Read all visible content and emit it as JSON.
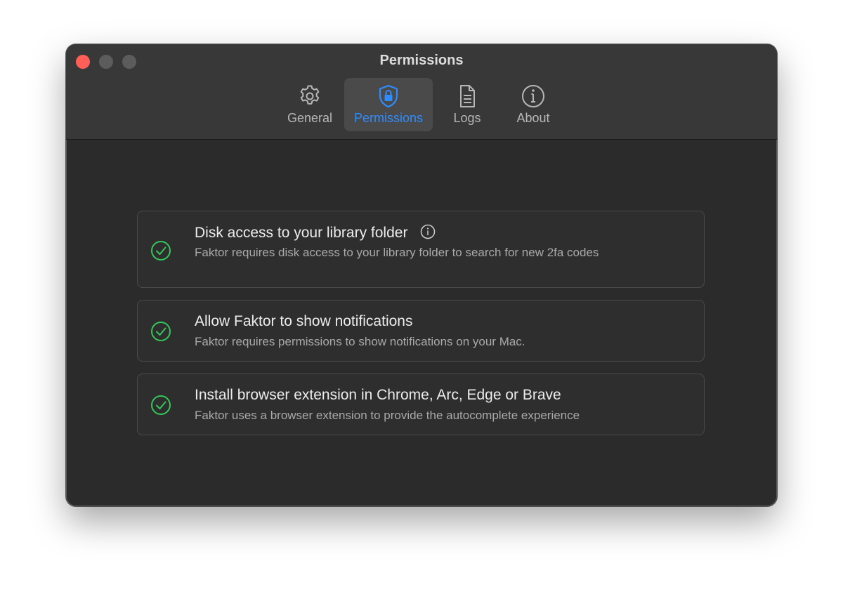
{
  "window": {
    "title": "Permissions"
  },
  "tabs": [
    {
      "label": "General",
      "icon": "gear-icon",
      "active": false
    },
    {
      "label": "Permissions",
      "icon": "shield-lock-icon",
      "active": true
    },
    {
      "label": "Logs",
      "icon": "document-icon",
      "active": false
    },
    {
      "label": "About",
      "icon": "info-icon",
      "active": false
    }
  ],
  "permissions": [
    {
      "title": "Disk access to your library folder",
      "description": "Faktor requires disk access to your library folder to search for new 2fa codes",
      "status": "granted",
      "has_info": true
    },
    {
      "title": "Allow Faktor to show notifications",
      "description": "Faktor requires permissions to show notifications on your Mac.",
      "status": "granted",
      "has_info": false
    },
    {
      "title": "Install browser extension in Chrome, Arc, Edge or Brave",
      "description": "Faktor uses a browser extension to provide the autocomplete experience",
      "status": "granted",
      "has_info": false
    }
  ],
  "colors": {
    "accent": "#2f8cff",
    "success": "#34c759",
    "close": "#ff5f57"
  }
}
